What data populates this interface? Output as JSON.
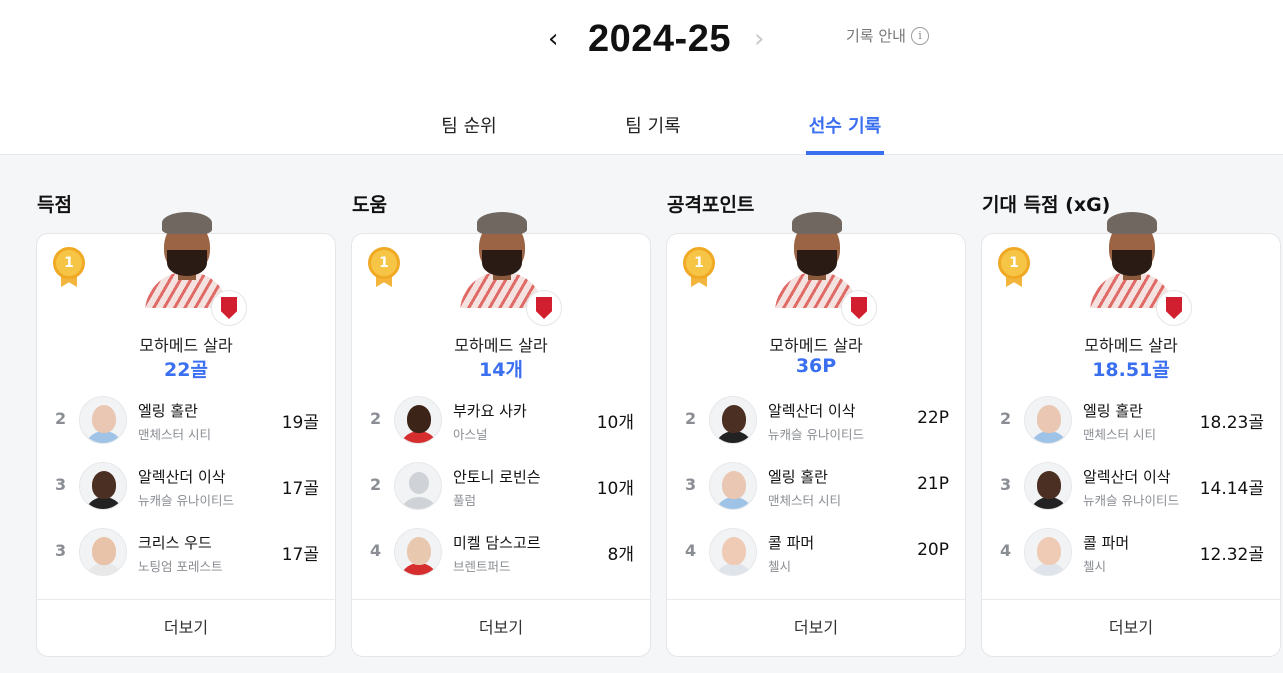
{
  "header": {
    "season": "2024-25",
    "prev_icon": "chevron-left-icon",
    "next_icon": "chevron-right-icon",
    "guide_label": "기록 안내",
    "guide_icon": "info-icon"
  },
  "tabs": [
    {
      "label": "팀 순위",
      "active": false
    },
    {
      "label": "팀 기록",
      "active": false
    },
    {
      "label": "선수 기록",
      "active": true
    }
  ],
  "colors": {
    "accent": "#3a6ff0",
    "medal": "#f7c545"
  },
  "sections": [
    {
      "title": "득점",
      "leader": {
        "rank": "1",
        "name": "모하메드 살라",
        "value": "22골",
        "club_icon": "liverpool-crest-icon"
      },
      "rows": [
        {
          "rank": "2",
          "name": "엘링 홀란",
          "club": "맨체스터 시티",
          "value": "19골",
          "skin": "#e9c7b2",
          "shirt": "#9fc3e6"
        },
        {
          "rank": "3",
          "name": "알렉산더 이삭",
          "club": "뉴캐슬 유나이티드",
          "value": "17골",
          "skin": "#4a2f22",
          "shirt": "#222222"
        },
        {
          "rank": "3",
          "name": "크리스 우드",
          "club": "노팅엄 포레스트",
          "value": "17골",
          "skin": "#e8c3a9",
          "shirt": "#e8e8e8"
        }
      ],
      "more_label": "더보기"
    },
    {
      "title": "도움",
      "leader": {
        "rank": "1",
        "name": "모하메드 살라",
        "value": "14개",
        "club_icon": "liverpool-crest-icon"
      },
      "rows": [
        {
          "rank": "2",
          "name": "부카요 사카",
          "club": "아스널",
          "value": "10개",
          "skin": "#3c2418",
          "shirt": "#d62e2e"
        },
        {
          "rank": "2",
          "name": "안토니 로빈슨",
          "club": "풀럼",
          "value": "10개",
          "skin": "",
          "shirt": "",
          "generic": true
        },
        {
          "rank": "4",
          "name": "미켈 담스고르",
          "club": "브렌트퍼드",
          "value": "8개",
          "skin": "#e9c8b0",
          "shirt": "#d62e2e"
        }
      ],
      "more_label": "더보기"
    },
    {
      "title": "공격포인트",
      "leader": {
        "rank": "1",
        "name": "모하메드 살라",
        "value": "36P",
        "club_icon": "liverpool-crest-icon"
      },
      "rows": [
        {
          "rank": "2",
          "name": "알렉산더 이삭",
          "club": "뉴캐슬 유나이티드",
          "value": "22P",
          "skin": "#4a2f22",
          "shirt": "#222222"
        },
        {
          "rank": "3",
          "name": "엘링 홀란",
          "club": "맨체스터 시티",
          "value": "21P",
          "skin": "#e9c7b2",
          "shirt": "#9fc3e6"
        },
        {
          "rank": "4",
          "name": "콜 파머",
          "club": "첼시",
          "value": "20P",
          "skin": "#efcbb5",
          "shirt": "#dfe3ea"
        }
      ],
      "more_label": "더보기"
    },
    {
      "title": "기대 득점 (xG)",
      "leader": {
        "rank": "1",
        "name": "모하메드 살라",
        "value": "18.51골",
        "club_icon": "liverpool-crest-icon"
      },
      "rows": [
        {
          "rank": "2",
          "name": "엘링 홀란",
          "club": "맨체스터 시티",
          "value": "18.23골",
          "skin": "#e9c7b2",
          "shirt": "#9fc3e6"
        },
        {
          "rank": "3",
          "name": "알렉산더 이삭",
          "club": "뉴캐슬 유나이티드",
          "value": "14.14골",
          "skin": "#4a2f22",
          "shirt": "#222222"
        },
        {
          "rank": "4",
          "name": "콜 파머",
          "club": "첼시",
          "value": "12.32골",
          "skin": "#efcbb5",
          "shirt": "#dfe3ea"
        }
      ],
      "more_label": "더보기"
    }
  ]
}
